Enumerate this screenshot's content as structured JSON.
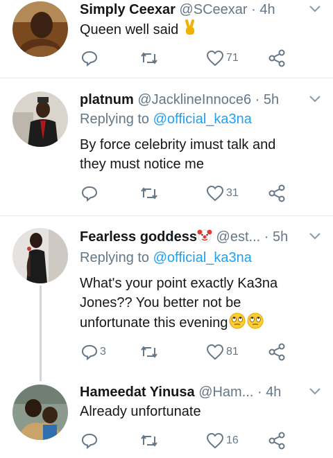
{
  "tweets": [
    {
      "name": "Simply Ceexar",
      "handle": "@SCeexar",
      "dot": "·",
      "time": "4h",
      "text": "Queen well said",
      "reply_label": "",
      "reply_mention": "",
      "replies": "",
      "likes": "71"
    },
    {
      "name": "platnum",
      "handle": "@JacklineInnoce6",
      "dot": "·",
      "time": "5h",
      "reply_label": "Replying to",
      "reply_mention": "@official_ka3na",
      "text_lines": [
        "By force celebrity imust talk and",
        "they must notice me"
      ],
      "replies": "",
      "likes": "31"
    },
    {
      "name": "Fearless goddess",
      "handle": "@est...",
      "dot": "·",
      "time": "5h",
      "reply_label": "Replying to",
      "reply_mention": "@official_ka3na",
      "text_lines": [
        "What's your point exactly Ka3na",
        "Jones?? You better not be",
        "unfortunate this evening"
      ],
      "replies": "3",
      "likes": "81"
    },
    {
      "name": "Hameedat Yinusa",
      "handle": "@Ham...",
      "dot": "·",
      "time": "4h",
      "text": "Already unfortunate",
      "replies": "",
      "likes": "16"
    }
  ],
  "icons": {
    "reply": "reply-icon",
    "retweet": "retweet-icon",
    "like": "heart-icon",
    "share": "share-icon",
    "more": "chevron-down-icon"
  },
  "colors": {
    "text": "#14171a",
    "muted": "#657786",
    "link": "#1da1f2",
    "divider": "#e1e8ed",
    "thread": "#ccd6dd"
  }
}
